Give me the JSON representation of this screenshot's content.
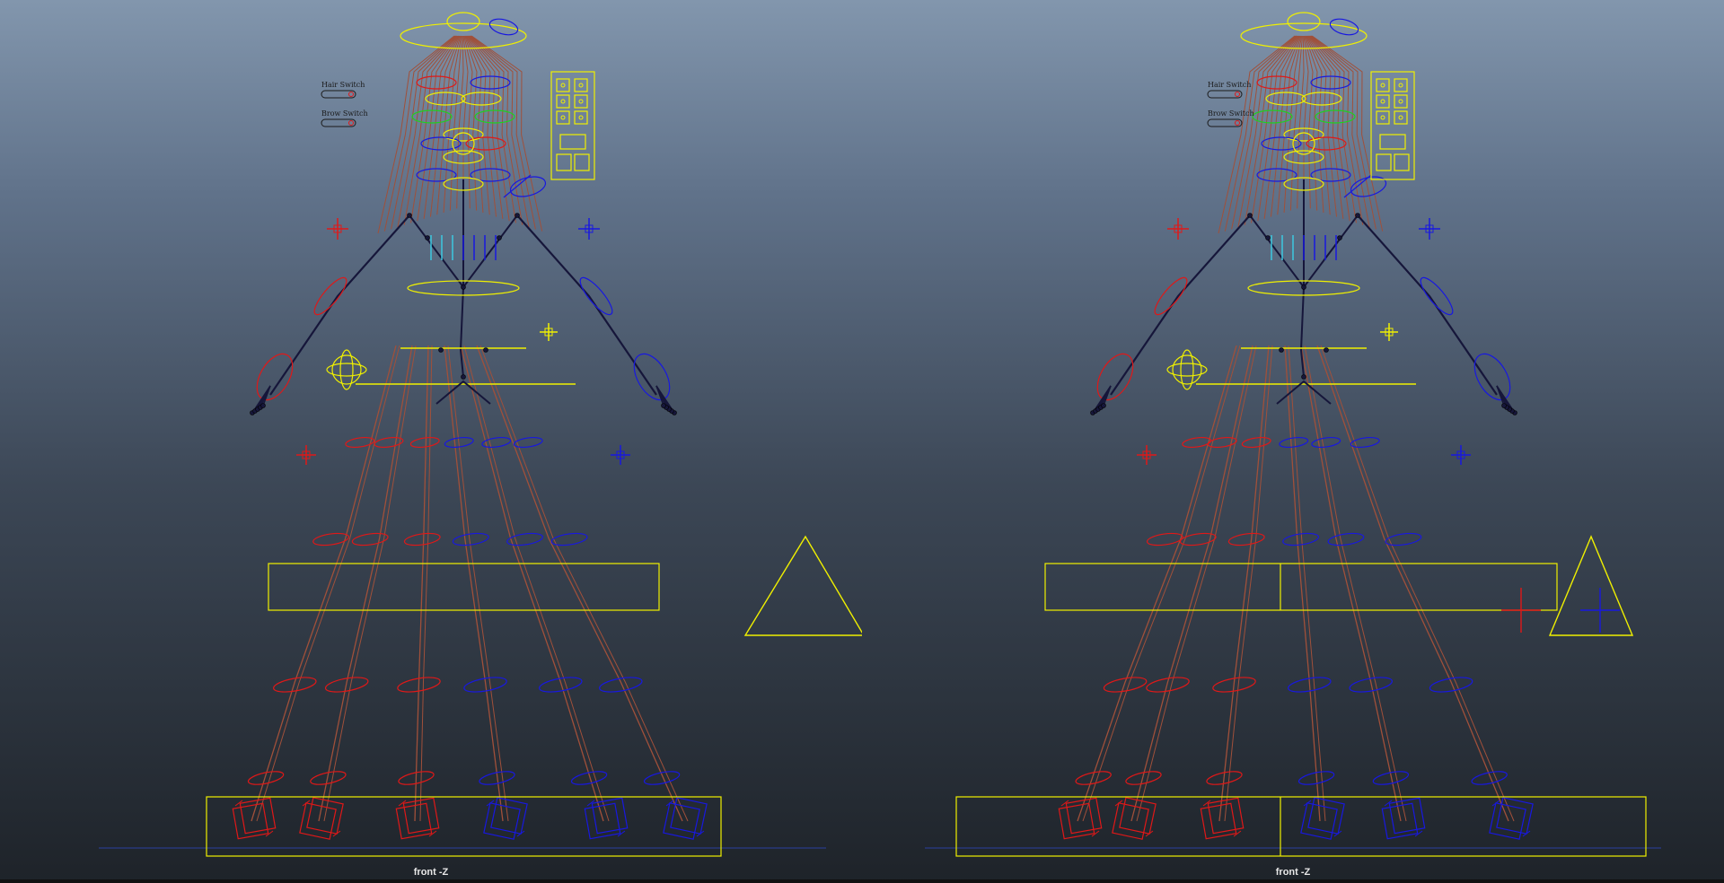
{
  "viewports": [
    {
      "id": "left",
      "label": "front -Z"
    },
    {
      "id": "right",
      "label": "front -Z"
    }
  ],
  "switches": {
    "hair": "Hair Switch",
    "brow": "Brow Switch"
  },
  "colors": {
    "background_top": "#8296ad",
    "background_bottom": "#1e2329",
    "bone": "#a0503a",
    "control_left": "#e01818",
    "control_right": "#1818e0",
    "control_center": "#f0f000",
    "joint_dark": "#16163a",
    "accent_cyan": "#3cc8e0",
    "accent_green": "#20d020",
    "grid_line": "#2a40a0"
  },
  "icons": [
    "hair-switch-icon",
    "brow-switch-icon",
    "facial-control-panel-icon",
    "ik-triangle-icon",
    "cross-locator-icon"
  ]
}
